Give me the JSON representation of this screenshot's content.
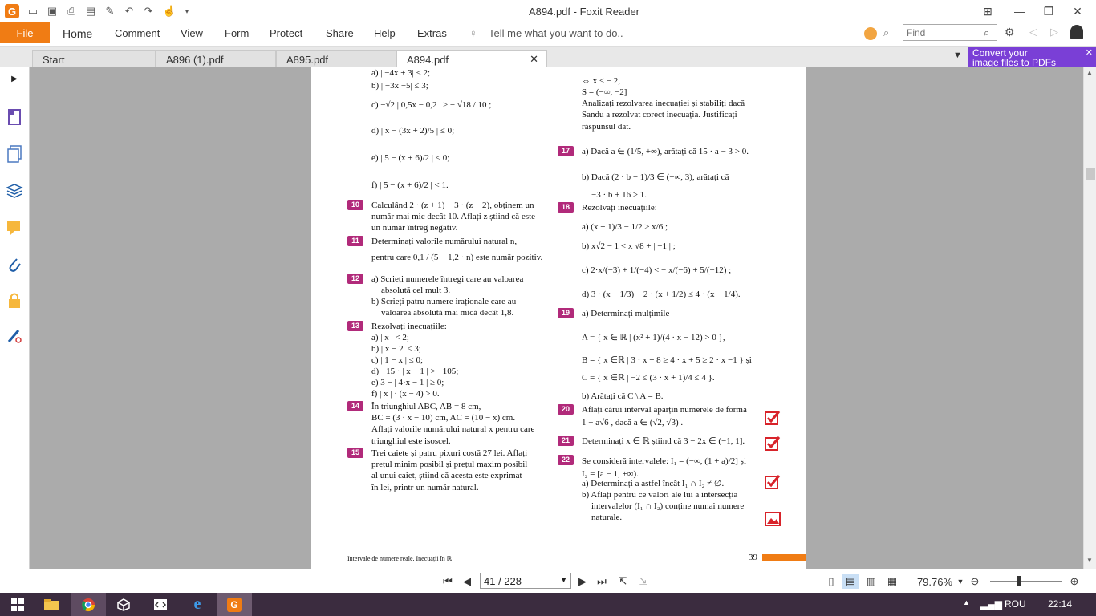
{
  "window": {
    "title": "A894.pdf - Foxit Reader"
  },
  "ribbon": {
    "file": "File",
    "tabs": [
      "Home",
      "Comment",
      "View",
      "Form",
      "Protect",
      "Share",
      "Help",
      "Extras"
    ],
    "tell_me": "Tell me what you want to do..",
    "find_placeholder": "Find"
  },
  "doc_tabs": [
    "Start",
    "A896 (1).pdf",
    "A895.pdf",
    "A894.pdf"
  ],
  "promo": {
    "line1": "Convert your",
    "line2": "image files to PDFs"
  },
  "page": {
    "left": [
      "a) | −4x + 3| < 2;",
      "b) | −3x −5| ≤ 3;",
      "c) −√2 | 0,5x − 0,2 | ≥ − √18 / 10 ;",
      "d) | x − (3x + 2)/5 | ≤ 0;",
      "e) | 5 − (x + 6)/2 | < 0;",
      "f) | 5 − (x + 6)/2 | < 1.",
      "Calculând 2 · (z + 1) − 3 · (z − 2), obținem un",
      "număr mai mic decât 10. Aflați z știind că este",
      "un număr întreg negativ.",
      "Determinați valorile numărului natural n,",
      "pentru care   0,1 / (5 − 1,2 · n)   este număr pozitiv.",
      "a) Scrieți numerele întregi care au valoarea",
      "absolută cel mult 3.",
      "b) Scrieți patru numere iraționale care au",
      "valoarea absolută mai mică decât 1,8.",
      "Rezolvați inecuațiile:",
      "a) | x | < 2;",
      "b) | x − 2| ≤ 3;",
      "c) | 1 − x | ≤ 0;",
      "d) −15 · | x − 1 | > −105;",
      "e) 3 − | 4·x − 1 | ≥ 0;",
      "f) | x | · (x − 4) > 0.",
      "În triunghiul ABC, AB = 8 cm,",
      "BC = (3 · x − 10) cm, AC = (10 − x) cm.",
      "Aflați valorile numărului natural x pentru care",
      "triunghiul este isoscel.",
      "Trei caiete și patru pixuri costă 27 lei. Aflați",
      "prețul minim posibil și prețul maxim posibil",
      "al unui caiet, știind că acesta este exprimat",
      "în lei, printr-un număr natural."
    ],
    "right": [
      "⇔ x ≤ − 2,",
      "S = (−∞, −2]",
      "Analizați rezolvarea inecuației și stabiliți dacă",
      "Sandu a rezolvat corect inecuația. Justificați",
      "răspunsul dat.",
      "a) Dacă a ∈ (1/5, +∞), arătați că 15 · a − 3 > 0.",
      "b) Dacă (2 · b − 1)/3 ∈ (−∞, 3), arătați că",
      "−3 · b + 16 > 1.",
      "Rezolvați inecuațiile:",
      "a) (x + 1)/3 − 1/2 ≥ x/6 ;",
      "b) x√2 − 1 < x √8 + | −1 | ;",
      "c) 2·x/(−3) + 1/(−4) < − x/(−6) + 5/(−12) ;",
      "d) 3 · (x − 1/3) − 2 · (x + 1/2) ≤ 4 · (x − 1/4).",
      "a) Determinați mulțimile",
      "A = { x ∈ ℝ | (x² + 1)/(4 · x − 12) > 0 },",
      "B = { x ∈ℝ | 3 · x + 8 ≥ 4 · x + 5 ≥ 2 · x −1 } și",
      "C = { x ∈ℝ | −2 ≤ (3 · x + 1)/4 ≤ 4 }.",
      "b) Arătați că C \\ A = B.",
      "Aflați cărui interval aparțin numerele de forma",
      "1 − a√6 , dacă a ∈ (√2, √3) .",
      "Determinați x ∈ ℝ știind că 3 − 2x ∈ (−1, 1].",
      "Se consideră intervalele: I₁ = (−∞, (1 + a)/2] și",
      "I₂ = [a − 1, +∞).",
      "a) Determinați a astfel încât I₁ ∩ I₂ ≠ ∅.",
      "b) Aflați pentru ce valori ale lui a intersecția",
      "intervalelor (I₁ ∩ I₂) conține numai numere",
      "naturale."
    ],
    "numbers": [
      "10",
      "11",
      "12",
      "13",
      "14",
      "15",
      "17",
      "18",
      "19",
      "20",
      "21",
      "22"
    ],
    "footer_text": "Intervale de numere reale. Inecuații în ℝ",
    "page_number": "39"
  },
  "status": {
    "page_field": "41 / 228",
    "zoom": "79.76%"
  },
  "taskbar": {
    "lang": "ROU",
    "time": "22:14"
  },
  "colors": {
    "accent": "#f07c14",
    "problem_number": "#b12a7a",
    "taskbar": "#3b2c3f"
  }
}
